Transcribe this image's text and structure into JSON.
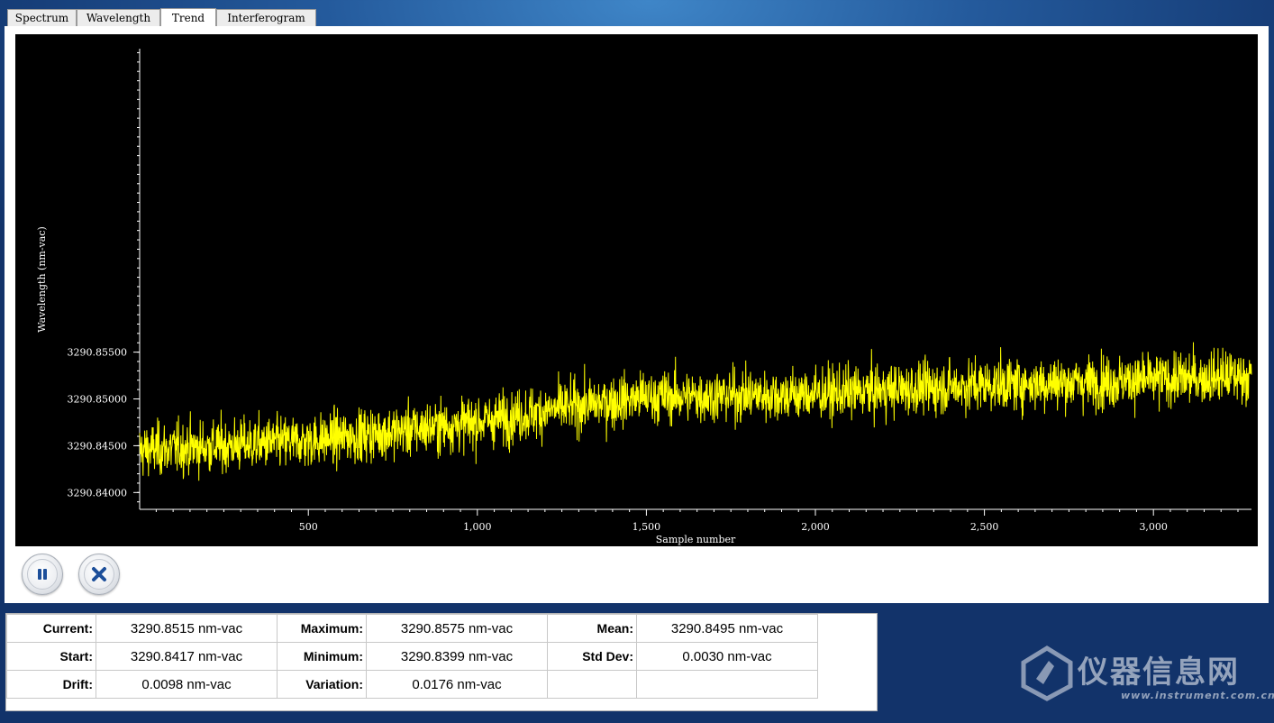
{
  "tabs": [
    {
      "label": "Spectrum",
      "active": false
    },
    {
      "label": "Wavelength",
      "active": false
    },
    {
      "label": "Trend",
      "active": true
    },
    {
      "label": "Interferogram",
      "active": false
    }
  ],
  "colors": {
    "plot_background": "#000000",
    "series": "#ffff00",
    "axis": "#ffffff"
  },
  "chart_data": {
    "type": "line",
    "xlabel": "Sample number",
    "ylabel": "Wavelength (nm-vac)",
    "xlim": [
      1,
      3290
    ],
    "ylim": [
      3290.8382,
      3290.8882
    ],
    "x_ticks": [
      {
        "value": 500,
        "label": "500"
      },
      {
        "value": 1000,
        "label": "1,000"
      },
      {
        "value": 1500,
        "label": "1,500"
      },
      {
        "value": 2000,
        "label": "2,000"
      },
      {
        "value": 2500,
        "label": "2,500"
      },
      {
        "value": 3000,
        "label": "3,000"
      }
    ],
    "y_ticks": [
      {
        "value": 3290.84,
        "label": "3290.84000"
      },
      {
        "value": 3290.845,
        "label": "3290.84500"
      },
      {
        "value": 3290.85,
        "label": "3290.85000"
      },
      {
        "value": 3290.855,
        "label": "3290.85500"
      }
    ],
    "grid": false,
    "series": [
      {
        "trend_points": [
          {
            "x": 1,
            "y": 3290.8445
          },
          {
            "x": 500,
            "y": 3290.8455
          },
          {
            "x": 1000,
            "y": 3290.8475
          },
          {
            "x": 1250,
            "y": 3290.849
          },
          {
            "x": 1500,
            "y": 3290.8502
          },
          {
            "x": 2000,
            "y": 3290.8505
          },
          {
            "x": 2500,
            "y": 3290.8515
          },
          {
            "x": 3000,
            "y": 3290.852
          },
          {
            "x": 3290,
            "y": 3290.8525
          }
        ],
        "noise_std": 0.0014,
        "samples": 3290
      }
    ]
  },
  "controls": {
    "pause_icon": "pause-icon",
    "stop_icon": "close-icon"
  },
  "stats": {
    "current_label": "Current:",
    "current_value": "3290.8515 nm-vac",
    "maximum_label": "Maximum:",
    "maximum_value": "3290.8575 nm-vac",
    "mean_label": "Mean:",
    "mean_value": "3290.8495 nm-vac",
    "start_label": "Start:",
    "start_value": "3290.8417 nm-vac",
    "minimum_label": "Minimum:",
    "minimum_value": "3290.8399 nm-vac",
    "stddev_label": "Std Dev:",
    "stddev_value": "0.0030 nm-vac",
    "drift_label": "Drift:",
    "drift_value": "0.0098 nm-vac",
    "variation_label": "Variation:",
    "variation_value": "0.0176 nm-vac"
  },
  "watermark": {
    "text": "仪器信息网",
    "url": "www.instrument.com.cn"
  }
}
